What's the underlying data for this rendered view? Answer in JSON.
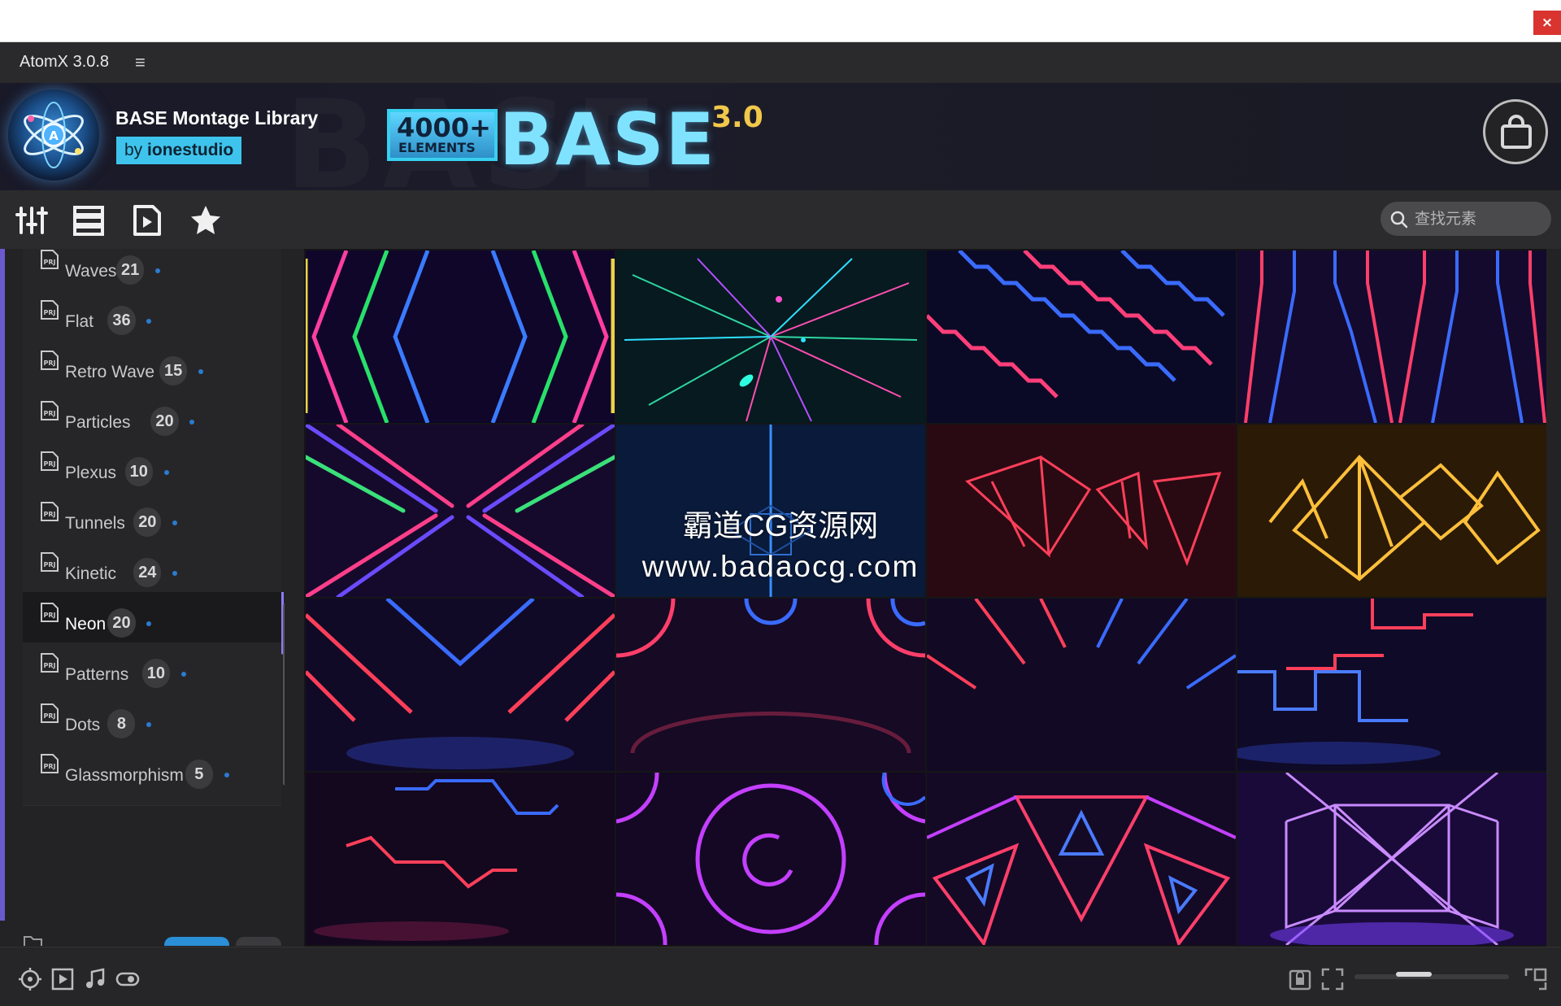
{
  "window": {
    "close_glyph": "×"
  },
  "app": {
    "title": "AtomX 3.0.8",
    "menu_glyph": "≡"
  },
  "banner": {
    "library_name": "BASE Montage Library",
    "by_prefix": "by",
    "author": "ionestudio",
    "count_text": "4000+",
    "elements_text": "ELEMENTS",
    "brand_text": "BASE",
    "version_text": "3.0"
  },
  "toolbar": {
    "icons": [
      "sliders-icon",
      "list-view-icon",
      "video-file-icon",
      "star-icon"
    ],
    "search_placeholder": "查找元素"
  },
  "sidebar": {
    "items": [
      {
        "label": "Waves",
        "count": "21",
        "active": false
      },
      {
        "label": "Flat",
        "count": "36",
        "active": false
      },
      {
        "label": "Retro Wave",
        "count": "15",
        "active": false
      },
      {
        "label": "Particles",
        "count": "20",
        "active": false
      },
      {
        "label": "Plexus",
        "count": "10",
        "active": false
      },
      {
        "label": "Tunnels",
        "count": "20",
        "active": false
      },
      {
        "label": "Kinetic",
        "count": "24",
        "active": false
      },
      {
        "label": "Neon",
        "count": "20",
        "active": true
      },
      {
        "label": "Patterns",
        "count": "10",
        "active": false
      },
      {
        "label": "Dots",
        "count": "8",
        "active": false
      },
      {
        "label": "Glassmorphism",
        "count": "5",
        "active": false
      }
    ],
    "prj_glyph": "PRJ"
  },
  "grid": {
    "tiles": [
      "neon-chevrons-rainbow",
      "particle-burst",
      "zigzag-stripes",
      "neon-forks",
      "neon-cross-lines",
      "blue-grid-cross",
      "red-pyramids",
      "gold-pyramids",
      "neon-v-red-blue",
      "neon-semicircles",
      "radial-rays",
      "step-lines",
      "zigzag-red",
      "purple-circles",
      "neon-triangles",
      "purple-cube"
    ]
  },
  "watermark": {
    "line1": "霸道CG资源网",
    "line2": "www.badaocg.com"
  },
  "statusbar": {
    "left_icons": [
      "move-icon",
      "play-icon",
      "music-note-icon",
      "eye-icon"
    ],
    "right_icons": [
      "lock-icon",
      "fit-icon",
      "fullscreen-icon"
    ],
    "zoom_fraction": 0.35
  }
}
